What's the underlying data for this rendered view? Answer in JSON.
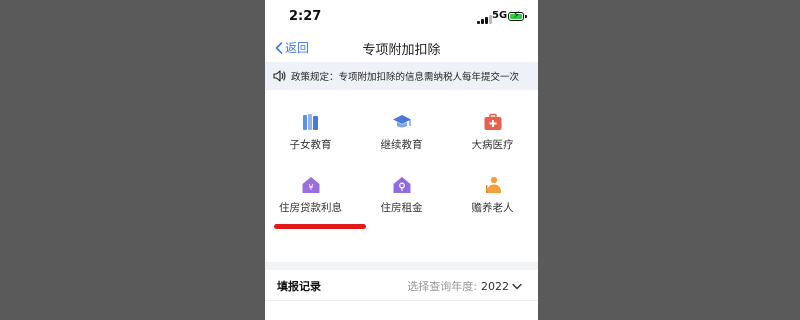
{
  "status_bar": {
    "time": "2:27",
    "network": "5G"
  },
  "nav": {
    "back_label": "返回",
    "title": "专项附加扣除"
  },
  "notice": {
    "text": "政策规定：专项附加扣除的信息需纳税人每年提交一次"
  },
  "categories": [
    {
      "label": "子女教育",
      "icon": "books-icon",
      "color": "#5b8fe8"
    },
    {
      "label": "继续教育",
      "icon": "graduation-cap-icon",
      "color": "#4a78d6"
    },
    {
      "label": "大病医疗",
      "icon": "medical-kit-icon",
      "color": "#e8604c"
    },
    {
      "label": "住房贷款利息",
      "icon": "house-loan-icon",
      "color": "#9b6ee0"
    },
    {
      "label": "住房租金",
      "icon": "house-key-icon",
      "color": "#8e6de0"
    },
    {
      "label": "赡养老人",
      "icon": "elder-person-icon",
      "color": "#f0a03c"
    }
  ],
  "records": {
    "title": "填报记录",
    "year_prompt": "选择查询年度:",
    "year": "2022"
  }
}
